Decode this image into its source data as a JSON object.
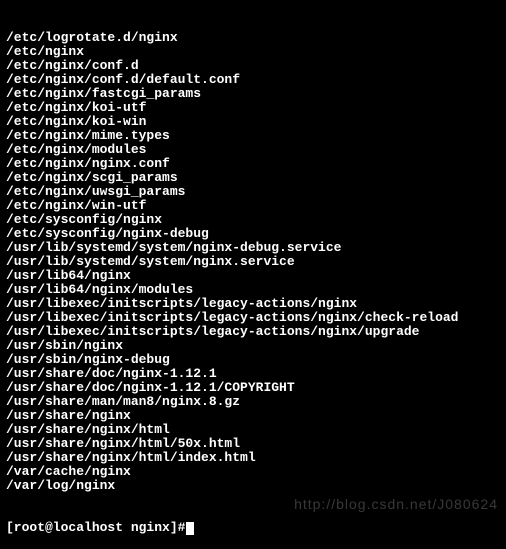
{
  "terminal": {
    "lines": [
      "/etc/logrotate.d/nginx",
      "/etc/nginx",
      "/etc/nginx/conf.d",
      "/etc/nginx/conf.d/default.conf",
      "/etc/nginx/fastcgi_params",
      "/etc/nginx/koi-utf",
      "/etc/nginx/koi-win",
      "/etc/nginx/mime.types",
      "/etc/nginx/modules",
      "/etc/nginx/nginx.conf",
      "/etc/nginx/scgi_params",
      "/etc/nginx/uwsgi_params",
      "/etc/nginx/win-utf",
      "/etc/sysconfig/nginx",
      "/etc/sysconfig/nginx-debug",
      "/usr/lib/systemd/system/nginx-debug.service",
      "/usr/lib/systemd/system/nginx.service",
      "/usr/lib64/nginx",
      "/usr/lib64/nginx/modules",
      "/usr/libexec/initscripts/legacy-actions/nginx",
      "/usr/libexec/initscripts/legacy-actions/nginx/check-reload",
      "/usr/libexec/initscripts/legacy-actions/nginx/upgrade",
      "/usr/sbin/nginx",
      "/usr/sbin/nginx-debug",
      "/usr/share/doc/nginx-1.12.1",
      "/usr/share/doc/nginx-1.12.1/COPYRIGHT",
      "/usr/share/man/man8/nginx.8.gz",
      "/usr/share/nginx",
      "/usr/share/nginx/html",
      "/usr/share/nginx/html/50x.html",
      "/usr/share/nginx/html/index.html",
      "/var/cache/nginx",
      "/var/log/nginx"
    ],
    "prompt": "[root@localhost nginx]#"
  },
  "watermark": "http://blog.csdn.net/J080624"
}
